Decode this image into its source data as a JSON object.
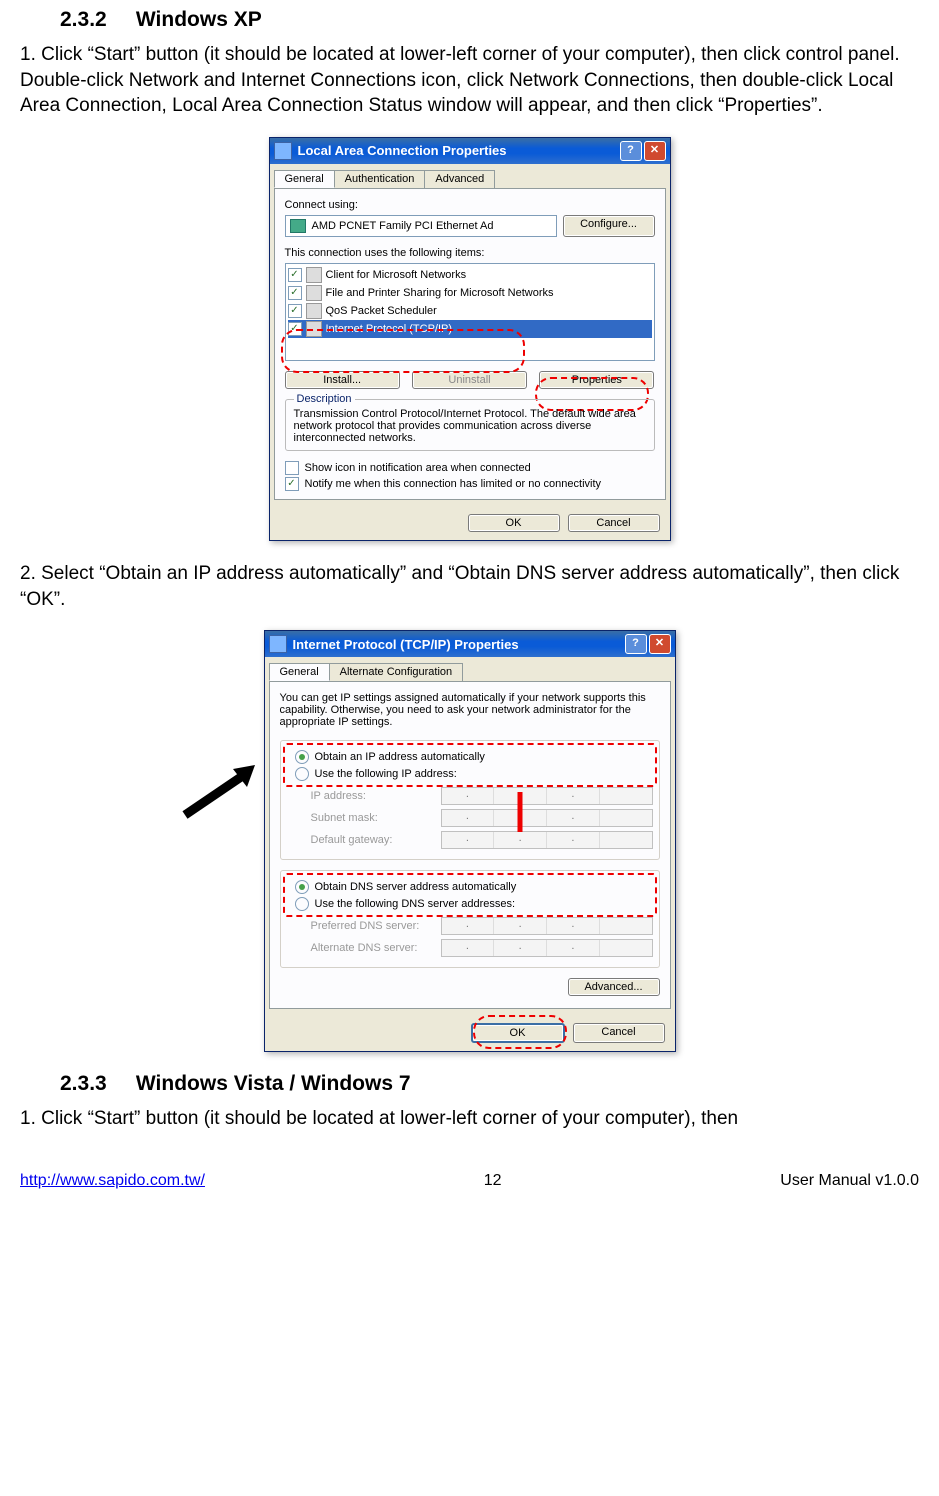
{
  "section232": {
    "num": "2.3.2",
    "title": "Windows XP"
  },
  "p1": "1.    Click “Start” button (it should be located at lower-left corner of your computer), then click control panel. Double-click Network and Internet Connections icon, click Network Connections, then double-click Local Area Connection, Local Area Connection Status window will appear, and then click “Properties”.",
  "fig1": {
    "title": "Local Area Connection Properties",
    "tabs": [
      "General",
      "Authentication",
      "Advanced"
    ],
    "connect_using_label": "Connect using:",
    "adapter": "AMD PCNET Family PCI Ethernet Ad",
    "configure": "Configure...",
    "items_label": "This connection uses the following items:",
    "items": [
      "Client for Microsoft Networks",
      "File and Printer Sharing for Microsoft Networks",
      "QoS Packet Scheduler",
      "Internet Protocol (TCP/IP)"
    ],
    "install": "Install...",
    "uninstall": "Uninstall",
    "properties": "Properties",
    "desc_legend": "Description",
    "desc_text": "Transmission Control Protocol/Internet Protocol. The default wide area network protocol that provides communication across diverse interconnected networks.",
    "show_icon": "Show icon in notification area when connected",
    "notify": "Notify me when this connection has limited or no connectivity",
    "ok": "OK",
    "cancel": "Cancel"
  },
  "p2": "2.    Select “Obtain an IP address automatically” and “Obtain DNS server address automatically”, then click “OK”.",
  "fig2": {
    "title": "Internet Protocol (TCP/IP) Properties",
    "tabs": [
      "General",
      "Alternate Configuration"
    ],
    "intro": "You can get IP settings assigned automatically if your network supports this capability. Otherwise, you need to ask your network administrator for the appropriate IP settings.",
    "obtain_ip": "Obtain an IP address automatically",
    "use_ip": "Use the following IP address:",
    "ip_label": "IP address:",
    "subnet_label": "Subnet mask:",
    "gateway_label": "Default gateway:",
    "obtain_dns": "Obtain DNS server address automatically",
    "use_dns": "Use the following DNS server addresses:",
    "pref_dns": "Preferred DNS server:",
    "alt_dns": "Alternate DNS server:",
    "advanced": "Advanced...",
    "ok": "OK",
    "cancel": "Cancel"
  },
  "section233": {
    "num": "2.3.3",
    "title": "Windows Vista / Windows 7"
  },
  "p3": "1.    Click “Start” button (it should be located at lower-left corner of your computer), then",
  "footer": {
    "url": "http://www.sapido.com.tw/",
    "page": "12",
    "right": "User  Manual  v1.0.0"
  }
}
